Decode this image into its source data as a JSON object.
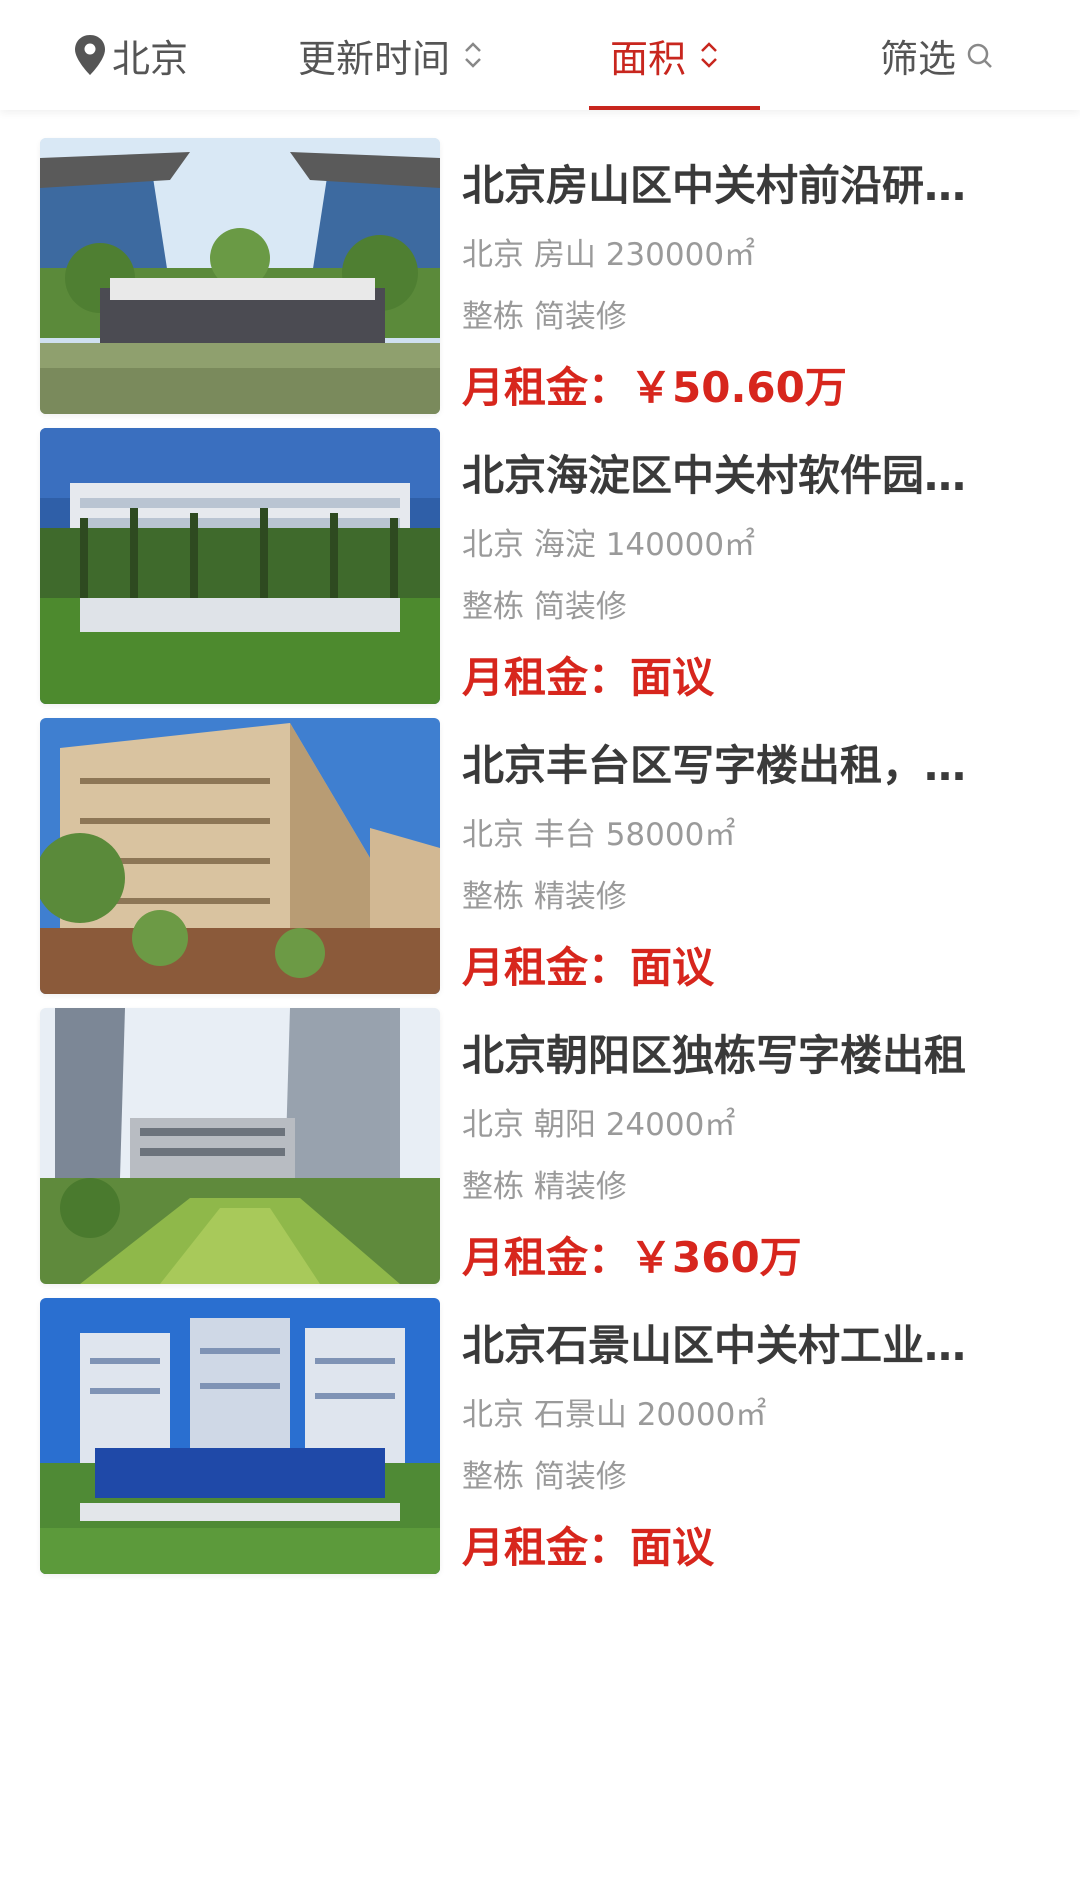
{
  "filter_bar": {
    "city": "北京",
    "update_time": "更新时间",
    "area": "面积",
    "filter": "筛选"
  },
  "colors": {
    "accent": "#c8261e",
    "price": "#d7261d",
    "meta": "#9a9a9a",
    "title": "#3a3a3a"
  },
  "listings": [
    {
      "title": "北京房山区中关村前沿研究院整栋出租",
      "meta": "北京 房山 230000㎡",
      "decoration": "整栋 简装修",
      "price": "月租金：￥50.60万"
    },
    {
      "title": "北京海淀区中关村软件园整栋出租",
      "meta": "北京 海淀 140000㎡",
      "decoration": "整栋 简装修",
      "price": "月租金：面议"
    },
    {
      "title": "北京丰台区写字楼出租，整栋",
      "meta": "北京 丰台 58000㎡",
      "decoration": "整栋 精装修",
      "price": "月租金：面议"
    },
    {
      "title": "北京朝阳区独栋写字楼出租",
      "meta": "北京 朝阳 24000㎡",
      "decoration": "整栋 精装修",
      "price": "月租金：￥360万"
    },
    {
      "title": "北京石景山区中关村工业互联网产业园",
      "meta": "北京 石景山 20000㎡",
      "decoration": "整栋 简装修",
      "price": "月租金：面议"
    }
  ]
}
